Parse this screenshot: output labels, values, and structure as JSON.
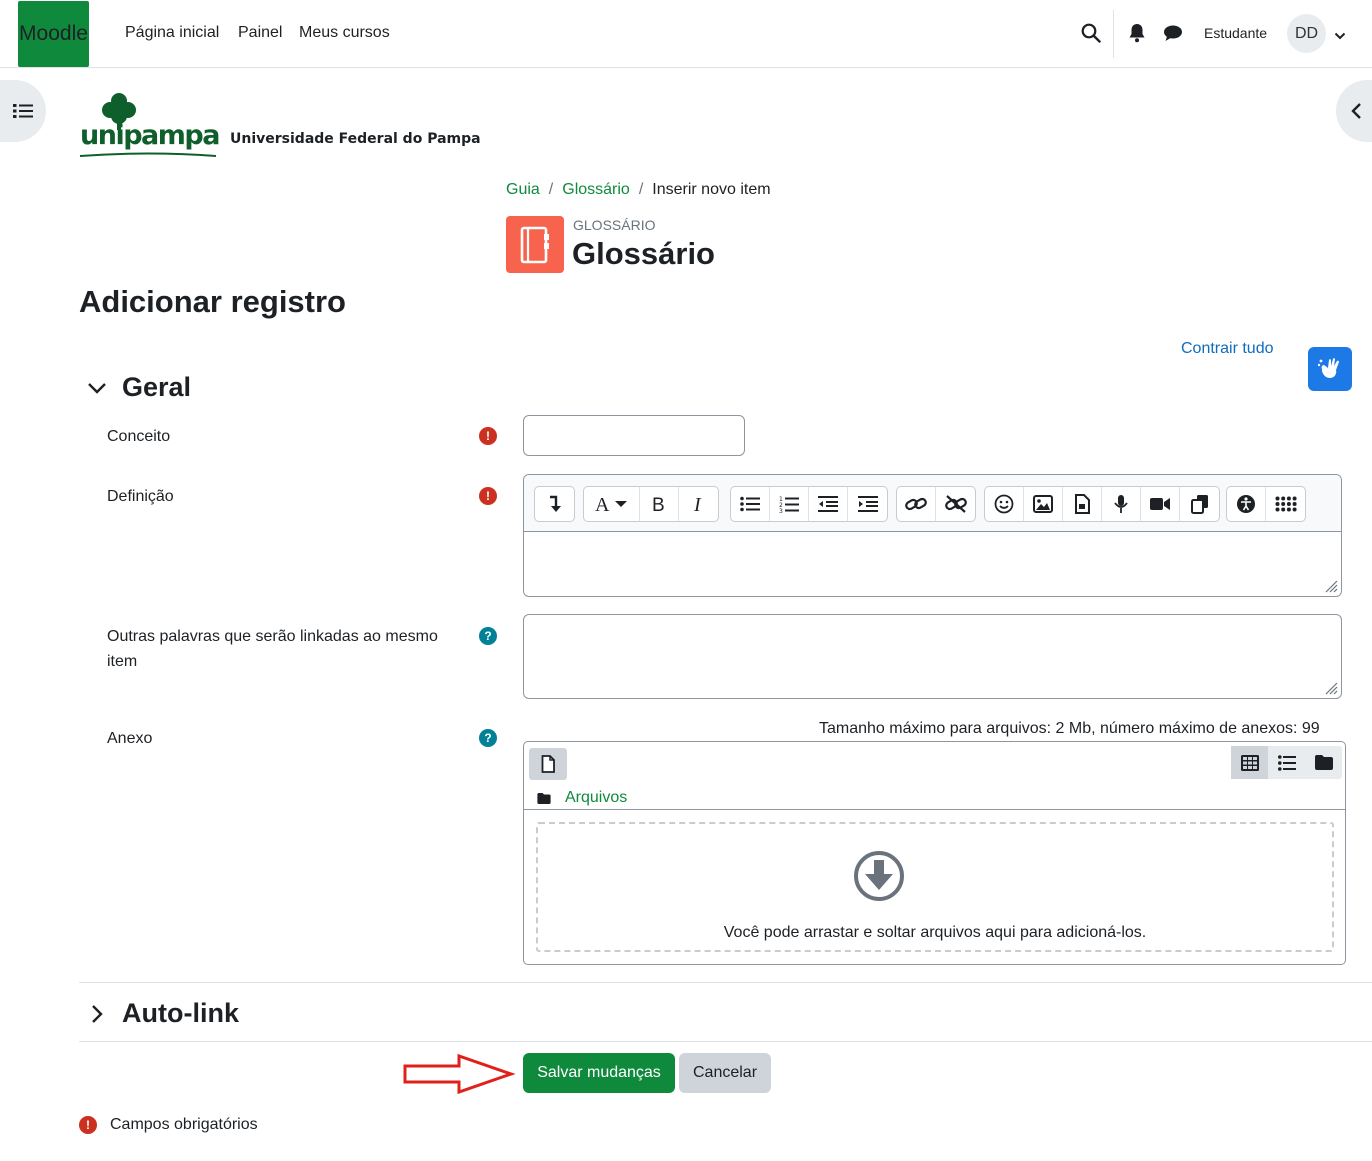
{
  "navbar": {
    "brand": "Moodle",
    "links": [
      "Página inicial",
      "Painel",
      "Meus cursos"
    ],
    "user_name": "Estudante",
    "avatar_initials": "DD"
  },
  "logo": {
    "wordmark": "unipampa",
    "subtitle": "Universidade Federal do Pampa"
  },
  "breadcrumb": [
    "Guia",
    "Glossário",
    "Inserir novo item"
  ],
  "module": {
    "pretitle": "GLOSSÁRIO",
    "title": "Glossário"
  },
  "page_title": "Adicionar registro",
  "collapse_all": "Contrair tudo",
  "sections": {
    "general": "Geral",
    "autolink": "Auto-link"
  },
  "fields": {
    "concept_label": "Conceito",
    "definition_label": "Definição",
    "aliases_label": "Outras palavras que serão linkadas ao mesmo item",
    "attachment_label": "Anexo"
  },
  "filemanager": {
    "limits": "Tamanho máximo para arquivos: 2 Mb, número máximo de anexos: 99",
    "path": "Arquivos",
    "drop_text": "Você pode arrastar e soltar arquivos aqui para adicioná-los."
  },
  "buttons": {
    "save": "Salvar mudanças",
    "cancel": "Cancelar"
  },
  "required_note": "Campos obrigatórios",
  "colors": {
    "primary": "#0f8a3c",
    "required": "#ca3120",
    "help": "#008196",
    "module_icon": "#f7634d",
    "link": "#0f6cbf",
    "annotation_arrow": "#e0201b"
  }
}
